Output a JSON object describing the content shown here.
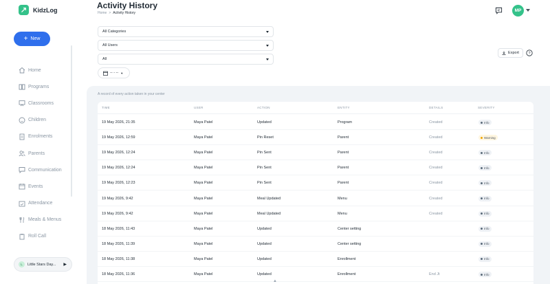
{
  "app": {
    "name": "KidzLog"
  },
  "header": {
    "title": "Activity History",
    "breadcrumb": {
      "home": "Home",
      "separator": ">",
      "current": "Activity History"
    },
    "avatar_initials": "MP"
  },
  "sidebar": {
    "new_label": "New",
    "items": [
      {
        "label": "Home",
        "icon": "home-icon"
      },
      {
        "label": "Programs",
        "icon": "book-icon"
      },
      {
        "label": "Classrooms",
        "icon": "chalkboard-icon"
      },
      {
        "label": "Children",
        "icon": "smile-icon"
      },
      {
        "label": "Enrolments",
        "icon": "document-icon"
      },
      {
        "label": "Parents",
        "icon": "users-icon"
      },
      {
        "label": "Communication",
        "icon": "chat-icon"
      },
      {
        "label": "Events",
        "icon": "calendar-icon"
      },
      {
        "label": "Attendance",
        "icon": "calendar-check-icon"
      },
      {
        "label": "Meals & Menus",
        "icon": "meal-icon"
      },
      {
        "label": "Roll Call",
        "icon": "clipboard-icon"
      }
    ],
    "center": {
      "initial": "L",
      "name": "Little Stars Day..."
    }
  },
  "filters": {
    "category": "All Categories",
    "user": "All Users",
    "severity": "All",
    "date": "-- - --"
  },
  "toolbar": {
    "export_label": "Export"
  },
  "table": {
    "caption": "A record of every action taken in your center",
    "columns": [
      "TIME",
      "USER",
      "ACTION",
      "ENTITY",
      "DETAILS",
      "SEVERITY"
    ],
    "rows": [
      {
        "time": "19 May 2026, 21:35",
        "user": "Maya Patel",
        "action": "Updated",
        "entity": "Program",
        "details": "Created",
        "severity": "Info"
      },
      {
        "time": "19 May 2026, 12:59",
        "user": "Maya Patel",
        "action": "Pin Reset",
        "entity": "Parent",
        "details": "Created",
        "severity": "Warning"
      },
      {
        "time": "19 May 2026, 12:24",
        "user": "Maya Patel",
        "action": "Pin Sent",
        "entity": "Parent",
        "details": "Created",
        "severity": "Info"
      },
      {
        "time": "19 May 2026, 12:24",
        "user": "Maya Patel",
        "action": "Pin Sent",
        "entity": "Parent",
        "details": "Created",
        "severity": "Info"
      },
      {
        "time": "19 May 2026, 12:23",
        "user": "Maya Patel",
        "action": "Pin Sent",
        "entity": "Parent",
        "details": "Created",
        "severity": "Info"
      },
      {
        "time": "19 May 2026, 9:42",
        "user": "Maya Patel",
        "action": "Meal Updated",
        "entity": "Menu",
        "details": "Created",
        "severity": "Info"
      },
      {
        "time": "19 May 2026, 9:42",
        "user": "Maya Patel",
        "action": "Meal Updated",
        "entity": "Menu",
        "details": "Created",
        "severity": "Info"
      },
      {
        "time": "18 May 2026, 11:43",
        "user": "Maya Patel",
        "action": "Updated",
        "entity": "Center setting",
        "details": "",
        "severity": "Info"
      },
      {
        "time": "18 May 2026, 11:39",
        "user": "Maya Patel",
        "action": "Updated",
        "entity": "Center setting",
        "details": "",
        "severity": "Info"
      },
      {
        "time": "18 May 2026, 11:38",
        "user": "Maya Patel",
        "action": "Updated",
        "entity": "Enrollment",
        "details": "",
        "severity": "Info"
      },
      {
        "time": "18 May 2026, 11:36",
        "user": "Maya Patel",
        "action": "Updated",
        "entity": "Enrollment",
        "details": "End Jt",
        "severity": "Info"
      }
    ]
  },
  "colors": {
    "brand": "#34c28a",
    "primary": "#2f6fec",
    "info_dot": "#5b6b7b",
    "warning_dot": "#f0a500"
  }
}
